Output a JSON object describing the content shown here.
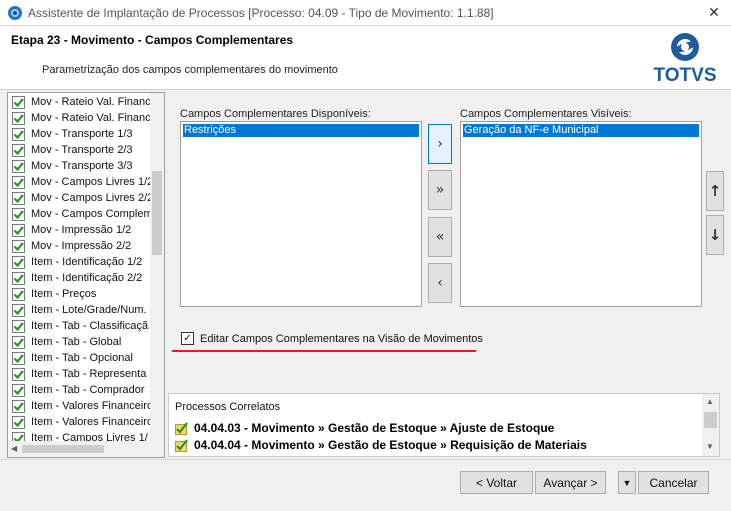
{
  "window": {
    "title": "Assistente de Implantação de Processos [Processo: 04.09 - Tipo de Movimento: 1.1.88]",
    "close_glyph": "✕"
  },
  "header": {
    "step_title": "Etapa 23 - Movimento - Campos Complementares",
    "description": "Parametrização dos campos complementares do movimento",
    "logo_text": "TOTVS"
  },
  "tree": {
    "items": [
      {
        "label": "Mov - Rateio Val. Financ"
      },
      {
        "label": "Mov - Rateio Val. Financ"
      },
      {
        "label": "Mov - Transporte 1/3"
      },
      {
        "label": "Mov - Transporte 2/3"
      },
      {
        "label": "Mov - Transporte 3/3"
      },
      {
        "label": "Mov - Campos Livres 1/2"
      },
      {
        "label": "Mov - Campos Livres 2/2"
      },
      {
        "label": "Mov - Campos Compleme"
      },
      {
        "label": "Mov - Impressão 1/2"
      },
      {
        "label": "Mov - Impressão 2/2"
      },
      {
        "label": "Item - Identificação 1/2"
      },
      {
        "label": "Item - Identificação 2/2"
      },
      {
        "label": "Item - Preços"
      },
      {
        "label": "Item - Lote/Grade/Num."
      },
      {
        "label": "Item - Tab - Classificaçã"
      },
      {
        "label": "Item - Tab - Global"
      },
      {
        "label": "Item - Tab - Opcional"
      },
      {
        "label": "Item - Tab - Representa"
      },
      {
        "label": "Item - Tab - Comprador"
      },
      {
        "label": "Item - Valores Financeiro"
      },
      {
        "label": "Item - Valores Financeiro"
      },
      {
        "label": "Item - Campos Livres 1/"
      }
    ]
  },
  "available": {
    "label": "Campos Complementares Disponíveis:",
    "items": [
      "Restrições"
    ]
  },
  "visible": {
    "label": "Campos Complementares Visíveis:",
    "items": [
      "Geração da NF-e Municipal"
    ]
  },
  "move_buttons": {
    "add_one": "›",
    "add_all": "»",
    "remove_all": "«",
    "remove_one": "‹"
  },
  "order_buttons": {
    "up": "↑",
    "down": "↓"
  },
  "edit_checkbox": {
    "label": "Editar Campos Complementares na Visão de Movimentos",
    "checked": true,
    "check_glyph": "✓"
  },
  "correlated": {
    "title": "Processos Correlatos",
    "items": [
      {
        "text": "04.04.03 - Movimento » Gestão de Estoque » Ajuste de Estoque"
      },
      {
        "text": "04.04.04 - Movimento » Gestão de Estoque » Requisição de Materiais"
      }
    ]
  },
  "footer": {
    "back": "< Voltar",
    "next": "Avançar >",
    "dropdown_glyph": "▼",
    "cancel": "Cancelar"
  },
  "colors": {
    "selection": "#0078d7",
    "highlight_underline": "#e31c1c",
    "logo_blue": "#1c5d9f"
  }
}
